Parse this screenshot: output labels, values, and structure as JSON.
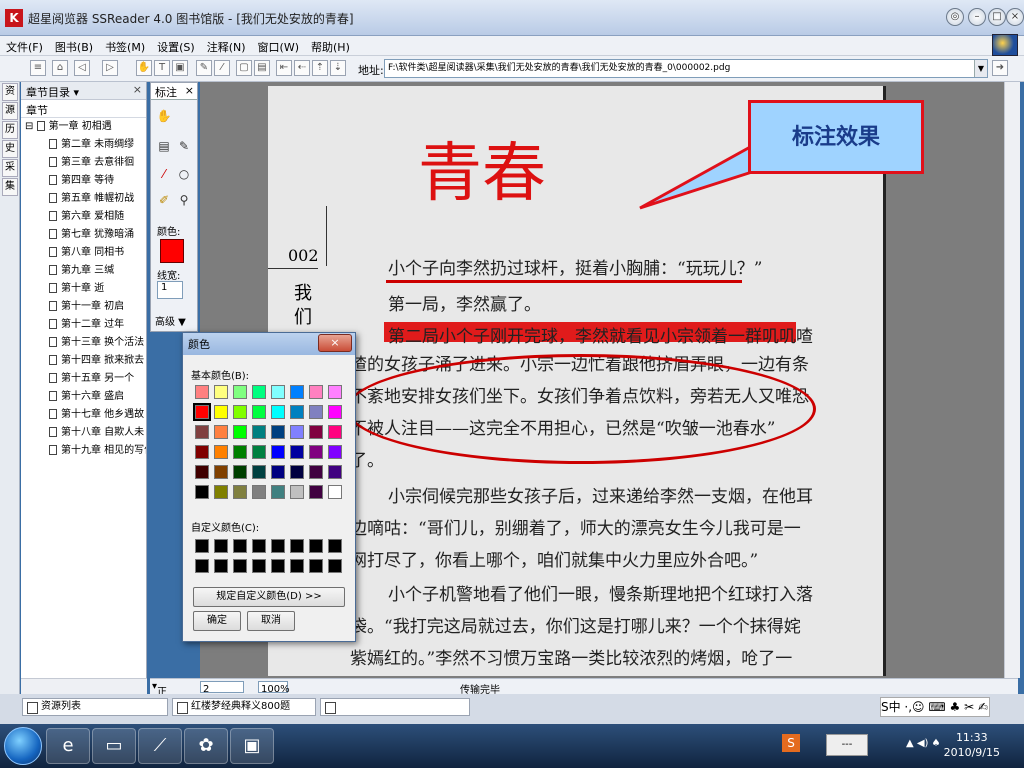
{
  "window": {
    "title": "超星阅览器 SSReader 4.0 图书馆版 - [我们无处安放的青春]",
    "logo": "K",
    "min": "–",
    "restore": "◎",
    "max": "□",
    "close": "×"
  },
  "menu": [
    "文件(F)",
    "图书(B)",
    "书签(M)",
    "设置(S)",
    "注释(N)",
    "窗口(W)",
    "帮助(H)"
  ],
  "toolbar": {
    "address_label": "地址:",
    "address": "F:\\软件类\\超星阅读器\\采集\\我们无处安放的青春\\我们无处安放的青春_0\\000002.pdg"
  },
  "side_tabs": [
    "资",
    "源",
    "历",
    "史",
    "采",
    "集"
  ],
  "toc": {
    "header": "章节目录",
    "sub": "章节",
    "root": "第一章 初相遇",
    "chapters": [
      "第二章 未雨绸缪",
      "第三章 去意徘徊",
      "第四章 等待",
      "第五章 帷幄初战",
      "第六章 爱相随",
      "第七章 犹豫暗涌",
      "第八章 同相书",
      "第九章 三缄",
      "第十章 逝",
      "第十一章 初启",
      "第十二章 过年",
      "第十三章 换个活法",
      "第十四章 掀来掀去",
      "第十五章 另一个",
      "第十六章 盛启",
      "第十七章 他乡遇故",
      "第十八章 自欺人未",
      "第十九章 相见的写作"
    ]
  },
  "annot_panel": {
    "title": "标注",
    "color_label": "颜色:",
    "width_label": "线宽:",
    "width_value": "1",
    "advanced": "高级 ▼",
    "color": "#ff0000"
  },
  "callout": "标注效果",
  "book": {
    "page_no": "002",
    "handwriting": "青春",
    "side_text": "我们",
    "lines": [
      "小个子向李然扔过球杆，挺着小胸脯：“玩玩儿？”",
      "第一局，李然赢了。",
      "第二局小个子刚开完球，李然就看见小宗领着一群叽叽喳",
      "喳的女孩子涌了进来。小宗一边忙着跟他挤眉弄眼，一边有条",
      "不紊地安排女孩们坐下。女孩们争着点饮料，旁若无人又唯恐",
      "不被人注目——这完全不用担心，已然是“吹皱一池春水”",
      "了。",
      "小宗伺候完那些女孩子后，过来递给李然一支烟，在他耳",
      "边嘀咕：“哥们儿，别绷着了，师大的漂亮女生今儿我可是一",
      "网打尽了，你看上哪个，咱们就集中火力里应外合吧。”",
      "小个子机警地看了他们一眼，慢条斯理地把个红球打入落",
      "袋。“我打完这局就过去，你们这是打哪儿来？一个个抹得姹",
      "紫嫣红的。”李然不习惯万宝路一类比较浓烈的烤烟，呛了一"
    ]
  },
  "status": {
    "view": "正文页",
    "page": "2",
    "zoom": "100%",
    "state": "传输完毕"
  },
  "dialog": {
    "title": "颜色",
    "basic_label": "基本颜色(B):",
    "custom_label": "自定义颜色(C):",
    "define_btn": "规定自定义颜色(D) >>",
    "ok": "确定",
    "cancel": "取消",
    "basic_colors": [
      "#ff8080",
      "#ffff80",
      "#80ff80",
      "#00ff80",
      "#80ffff",
      "#0080ff",
      "#ff80c0",
      "#ff80ff",
      "#ff0000",
      "#ffff00",
      "#80ff00",
      "#00ff40",
      "#00ffff",
      "#0080c0",
      "#8080c0",
      "#ff00ff",
      "#804040",
      "#ff8040",
      "#00ff00",
      "#008080",
      "#004080",
      "#8080ff",
      "#800040",
      "#ff0080",
      "#800000",
      "#ff8000",
      "#008000",
      "#008040",
      "#0000ff",
      "#0000a0",
      "#800080",
      "#8000ff",
      "#400000",
      "#804000",
      "#004000",
      "#004040",
      "#000080",
      "#000040",
      "#400040",
      "#400080",
      "#000000",
      "#808000",
      "#808040",
      "#808080",
      "#408080",
      "#c0c0c0",
      "#400040",
      "#ffffff"
    ]
  },
  "doc_tabs": [
    "资源列表",
    "红楼梦经典释义800题",
    ""
  ],
  "ime": "S中 ·,☺ ⌨ ♣ ✂ ✍",
  "clock": {
    "time": "11:33",
    "date": "2010/9/15"
  }
}
